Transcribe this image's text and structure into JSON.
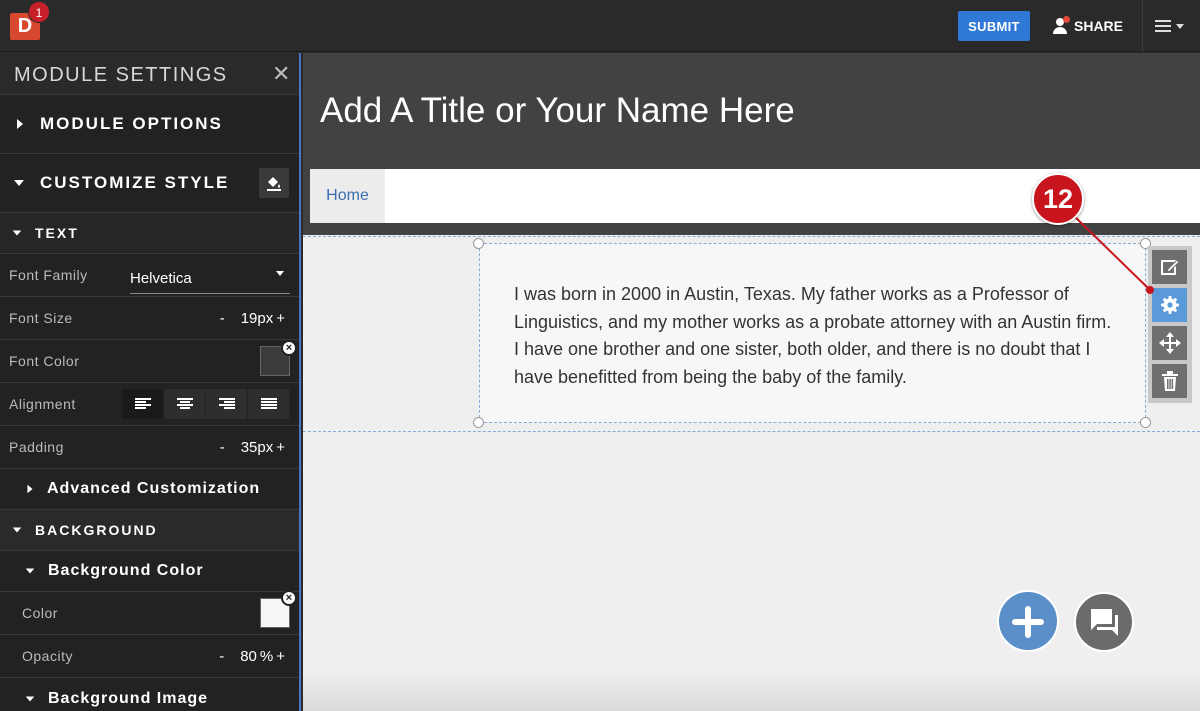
{
  "topbar": {
    "logo_letter": "D",
    "notification_count": "1",
    "submit_label": "SUBMIT",
    "share_label": "SHARE"
  },
  "sidebar": {
    "title": "MODULE SETTINGS",
    "close_glyph": "✕",
    "module_options": "MODULE OPTIONS",
    "customize_style": "CUSTOMIZE STYLE",
    "text_section": "TEXT",
    "font_family_label": "Font Family",
    "font_family_value": "Helvetica",
    "font_size_label": "Font Size",
    "font_size_value": "19",
    "font_size_unit": "px",
    "font_color_label": "Font Color",
    "font_color": "#3b3b3b",
    "alignment_label": "Alignment",
    "padding_label": "Padding",
    "padding_value": "35",
    "padding_unit": "px",
    "advanced": "Advanced Customization",
    "background_section": "BACKGROUND",
    "background_color_section": "Background Color",
    "color_label": "Color",
    "bg_color": "#f7f7f7",
    "opacity_label": "Opacity",
    "opacity_value": "80",
    "opacity_unit": "%",
    "background_image_section": "Background Image",
    "minus": "-",
    "plus": "+",
    "clear_glyph": "×"
  },
  "canvas": {
    "hero_title": "Add A Title or Your Name Here",
    "nav_home": "Home",
    "paragraph": "I was born in 2000 in Austin, Texas. My father works as a Professor of Linguistics, and my mother works as a probate attorney with an Austin firm. I have one brother and one sister, both older, and there is no doubt that I have benefitted from being the baby of the family."
  },
  "annotation": {
    "step_number": "12"
  },
  "icons": {
    "module_tools": [
      "edit-icon",
      "gear-icon",
      "move-icon",
      "trash-icon"
    ],
    "fabs": [
      "add-icon",
      "chat-icon"
    ]
  },
  "colors": {
    "accent": "#2f78d6",
    "sidebar_bg": "#222222",
    "hero_bg": "#424242",
    "callout": "#c8141c",
    "active_tool": "#5b9ad8"
  }
}
